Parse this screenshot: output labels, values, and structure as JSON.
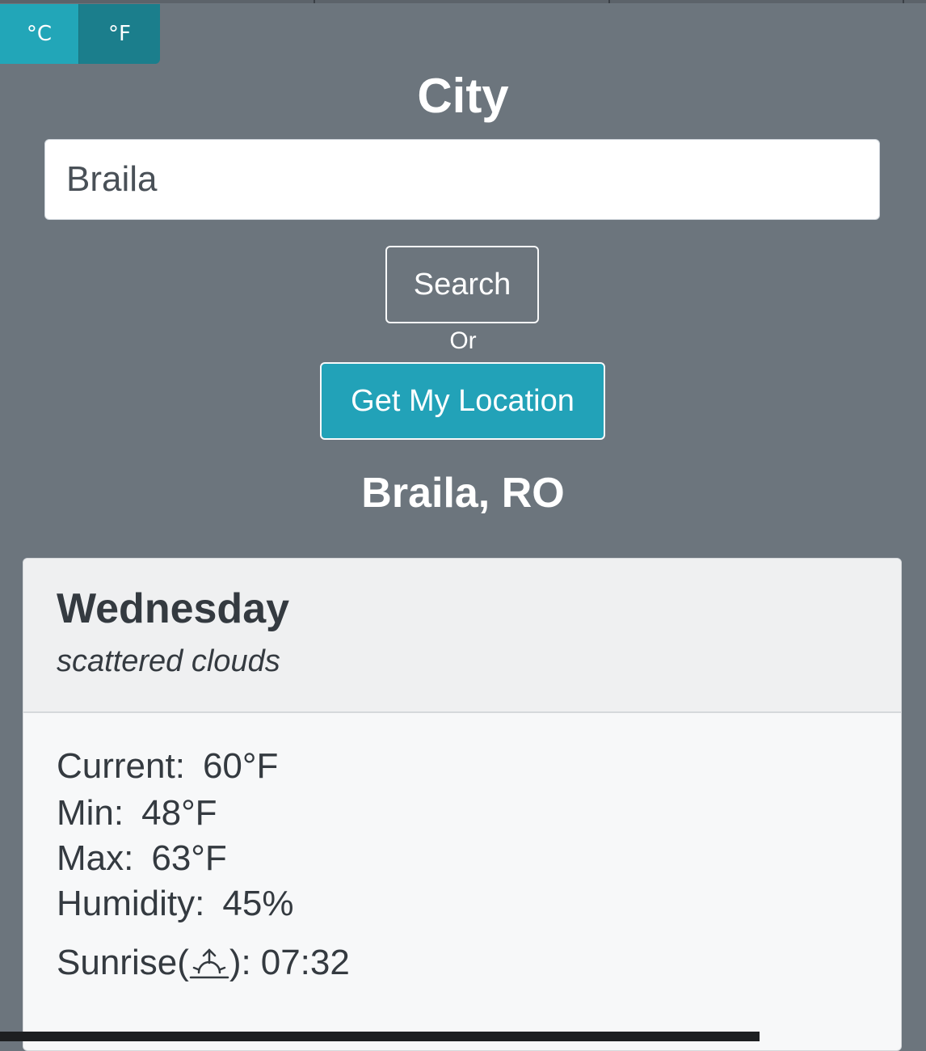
{
  "units": {
    "celsius_label": "°C",
    "fahrenheit_label": "°F"
  },
  "city_heading": "City",
  "search": {
    "value": "Braila",
    "button_label": "Search"
  },
  "or_text": "Or",
  "location_button_label": "Get My Location",
  "place": "Braila, RO",
  "forecast": {
    "day": "Wednesday",
    "description": "scattered clouds",
    "current_label": "Current:",
    "current_value": "60°F",
    "min_label": "Min:",
    "min_value": "48°F",
    "max_label": "Max:",
    "max_value": "63°F",
    "humidity_label": "Humidity:",
    "humidity_value": "45%",
    "sunrise_label_prefix": "Sunrise(",
    "sunrise_label_suffix": "):",
    "sunrise_value": "07:32",
    "sunrise_icon": "sunrise-icon"
  },
  "colors": {
    "background": "#6c757d",
    "accent": "#22a2b8",
    "card_bg": "#f7f8f9"
  }
}
